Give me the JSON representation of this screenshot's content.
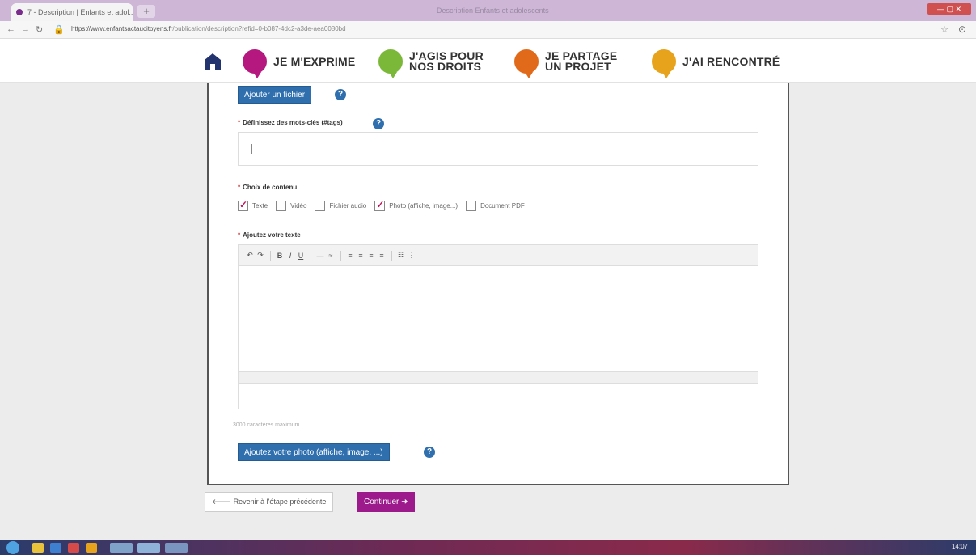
{
  "browser": {
    "tab_title": "7 - Description | Enfants et adol... ×",
    "new_tab": "+",
    "window_title": "Description Enfants et adolescents",
    "url_host": "https://www.enfantsactaucitoyens.fr",
    "url_path": "/publication/description?refid=0-b087-4dc2-a3de-aea0080bd"
  },
  "nav": {
    "items": [
      {
        "label_1": "JE M'EXPRIME",
        "label_2": "",
        "color": "#b5197f"
      },
      {
        "label_1": "J'AGIS POUR",
        "label_2": "NOS DROITS",
        "color": "#7bb83a"
      },
      {
        "label_1": "JE PARTAGE",
        "label_2": "UN PROJET",
        "color": "#e06a1a"
      },
      {
        "label_1": "J'AI RENCONTRÉ",
        "label_2": "",
        "color": "#e8a31c"
      }
    ]
  },
  "form": {
    "add_file_label": "Ajouter un fichier",
    "help": "?",
    "tags_label": "Définissez des mots-clés (#tags)",
    "required": "*",
    "content_label": "Choix de contenu",
    "content_options": [
      {
        "label": "Texte",
        "checked": true
      },
      {
        "label": "Vidéo",
        "checked": false
      },
      {
        "label": "Fichier audio",
        "checked": false
      },
      {
        "label": "Photo (affiche, image...)",
        "checked": true
      },
      {
        "label": "Document PDF",
        "checked": false
      }
    ],
    "text_label": "Ajoutez votre texte",
    "toolbar": [
      "↶",
      "↷",
      "B",
      "I",
      "U",
      "—",
      "≈",
      "≡",
      "≡",
      "≡",
      "≡",
      "☷",
      "⋮"
    ],
    "char_hint": "3000 caractères maximum",
    "add_photo_label": "Ajoutez votre photo (affiche, image, ...)"
  },
  "footer": {
    "back_label": "Revenir à l'étape précédente",
    "continue_label": "Continuer"
  },
  "taskbar": {
    "clock": "14:07"
  }
}
